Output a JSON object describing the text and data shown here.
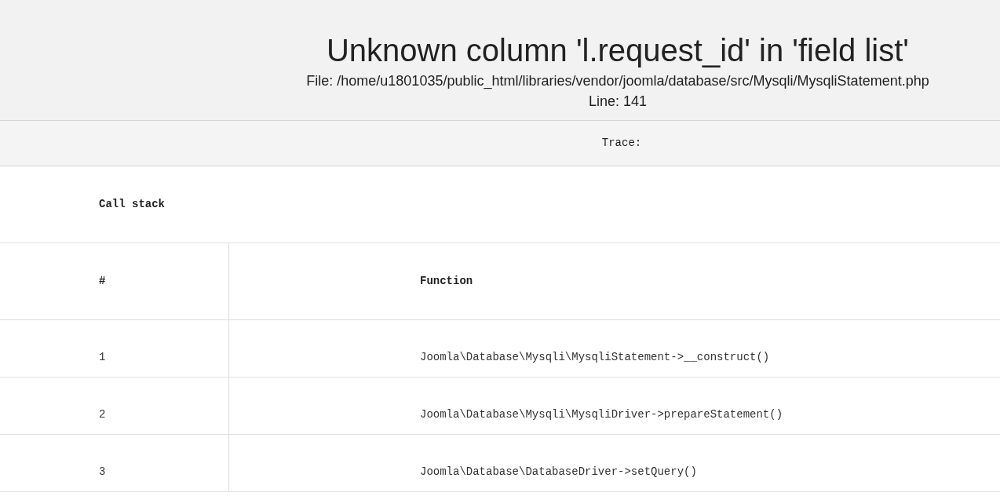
{
  "error": {
    "title": "Unknown column 'l.request_id' in 'field list'",
    "file": "File: /home/u1801035/public_html/libraries/vendor/joomla/database/src/Mysqli/MysqliStatement.php",
    "line": "Line: 141"
  },
  "trace_label": "Trace:",
  "call_stack": {
    "caption": "Call stack",
    "columns": [
      "#",
      "Function"
    ],
    "rows": [
      {
        "number": "1",
        "function": "Joomla\\Database\\Mysqli\\MysqliStatement->__construct()"
      },
      {
        "number": "2",
        "function": "Joomla\\Database\\Mysqli\\MysqliDriver->prepareStatement()"
      },
      {
        "number": "3",
        "function": "Joomla\\Database\\DatabaseDriver->setQuery()"
      }
    ]
  }
}
